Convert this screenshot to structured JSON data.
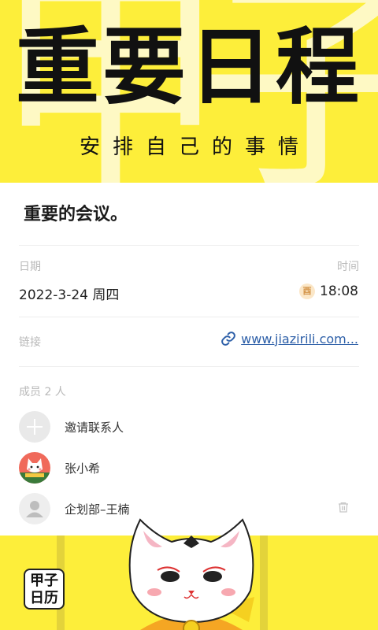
{
  "hero": {
    "title": "重要日程",
    "subtitle": "安排自己的事情",
    "background_glyphs": "甲子"
  },
  "event": {
    "title": "重要的会议。",
    "date_label": "日期",
    "date_value": "2022-3-24 周四",
    "time_label": "时间",
    "time_badge": "酉",
    "time_value": "18:08",
    "link_label": "链接",
    "link_value": "www.jiazirili.com..."
  },
  "members": {
    "header": "成员 2 人",
    "items": [
      {
        "name": "邀请联系人",
        "avatar": "plus-icon"
      },
      {
        "name": "张小希",
        "avatar": "cat-avatar"
      },
      {
        "name": "企划部–王楠",
        "avatar": "default-person-icon"
      }
    ]
  },
  "logo_text": "甲子日历",
  "colors": {
    "brand_yellow": "#fdee3a",
    "link_blue": "#2d5fa8",
    "badge_bg": "#fbe7c8",
    "badge_text": "#d4954a"
  }
}
